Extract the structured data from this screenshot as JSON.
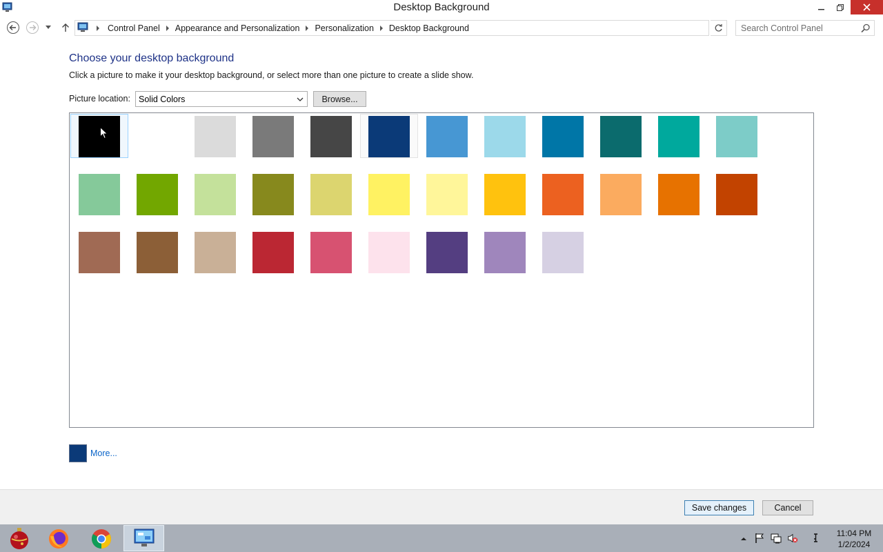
{
  "window": {
    "title": "Desktop Background"
  },
  "breadcrumb": [
    "Control Panel",
    "Appearance and Personalization",
    "Personalization",
    "Desktop Background"
  ],
  "search": {
    "placeholder": "Search Control Panel"
  },
  "content": {
    "heading": "Choose your desktop background",
    "instructions": "Click a picture to make it your desktop background, or select more than one picture to create a slide show.",
    "picture_location_label": "Picture location:",
    "picture_location_value": "Solid Colors",
    "browse_label": "Browse...",
    "more_label": "More...",
    "selected_color": "#0b3a78"
  },
  "swatches": [
    "#000000",
    "#ffffff",
    "#dbdbdb",
    "#7a7a7a",
    "#464646",
    "#0b3a78",
    "#4797d3",
    "#9cd9ea",
    "#0076a7",
    "#0b6b6d",
    "#00a99d",
    "#7dccc8",
    "#85c99a",
    "#72a700",
    "#c4e19b",
    "#87891d",
    "#dcd56f",
    "#fff262",
    "#fff69a",
    "#ffc20e",
    "#ec6120",
    "#fbab5f",
    "#e77200",
    "#c24300",
    "#a06a54",
    "#8c5f37",
    "#c9b097",
    "#bb2733",
    "#d75271",
    "#fde2ec",
    "#543e81",
    "#9f86bc",
    "#d6d0e3"
  ],
  "footer": {
    "save_label": "Save changes",
    "cancel_label": "Cancel"
  },
  "clock": {
    "time": "11:04 PM",
    "date": "1/2/2024"
  }
}
